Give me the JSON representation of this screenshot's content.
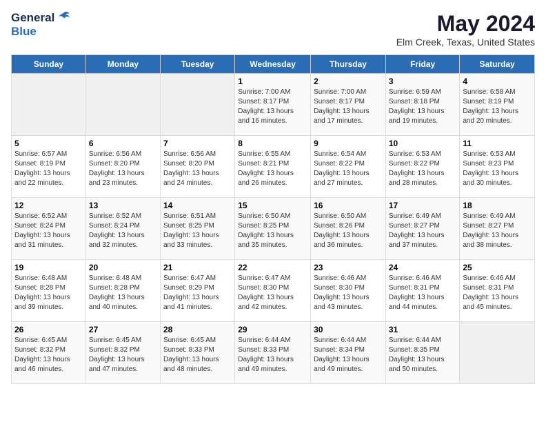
{
  "header": {
    "logo_general": "General",
    "logo_blue": "Blue",
    "title": "May 2024",
    "subtitle": "Elm Creek, Texas, United States"
  },
  "calendar": {
    "days_of_week": [
      "Sunday",
      "Monday",
      "Tuesday",
      "Wednesday",
      "Thursday",
      "Friday",
      "Saturday"
    ],
    "weeks": [
      [
        {
          "day": "",
          "info": ""
        },
        {
          "day": "",
          "info": ""
        },
        {
          "day": "",
          "info": ""
        },
        {
          "day": "1",
          "info": "Sunrise: 7:00 AM\nSunset: 8:17 PM\nDaylight: 13 hours\nand 16 minutes."
        },
        {
          "day": "2",
          "info": "Sunrise: 7:00 AM\nSunset: 8:17 PM\nDaylight: 13 hours\nand 17 minutes."
        },
        {
          "day": "3",
          "info": "Sunrise: 6:59 AM\nSunset: 8:18 PM\nDaylight: 13 hours\nand 19 minutes."
        },
        {
          "day": "4",
          "info": "Sunrise: 6:58 AM\nSunset: 8:19 PM\nDaylight: 13 hours\nand 20 minutes."
        }
      ],
      [
        {
          "day": "5",
          "info": "Sunrise: 6:57 AM\nSunset: 8:19 PM\nDaylight: 13 hours\nand 22 minutes."
        },
        {
          "day": "6",
          "info": "Sunrise: 6:56 AM\nSunset: 8:20 PM\nDaylight: 13 hours\nand 23 minutes."
        },
        {
          "day": "7",
          "info": "Sunrise: 6:56 AM\nSunset: 8:20 PM\nDaylight: 13 hours\nand 24 minutes."
        },
        {
          "day": "8",
          "info": "Sunrise: 6:55 AM\nSunset: 8:21 PM\nDaylight: 13 hours\nand 26 minutes."
        },
        {
          "day": "9",
          "info": "Sunrise: 6:54 AM\nSunset: 8:22 PM\nDaylight: 13 hours\nand 27 minutes."
        },
        {
          "day": "10",
          "info": "Sunrise: 6:53 AM\nSunset: 8:22 PM\nDaylight: 13 hours\nand 28 minutes."
        },
        {
          "day": "11",
          "info": "Sunrise: 6:53 AM\nSunset: 8:23 PM\nDaylight: 13 hours\nand 30 minutes."
        }
      ],
      [
        {
          "day": "12",
          "info": "Sunrise: 6:52 AM\nSunset: 8:24 PM\nDaylight: 13 hours\nand 31 minutes."
        },
        {
          "day": "13",
          "info": "Sunrise: 6:52 AM\nSunset: 8:24 PM\nDaylight: 13 hours\nand 32 minutes."
        },
        {
          "day": "14",
          "info": "Sunrise: 6:51 AM\nSunset: 8:25 PM\nDaylight: 13 hours\nand 33 minutes."
        },
        {
          "day": "15",
          "info": "Sunrise: 6:50 AM\nSunset: 8:25 PM\nDaylight: 13 hours\nand 35 minutes."
        },
        {
          "day": "16",
          "info": "Sunrise: 6:50 AM\nSunset: 8:26 PM\nDaylight: 13 hours\nand 36 minutes."
        },
        {
          "day": "17",
          "info": "Sunrise: 6:49 AM\nSunset: 8:27 PM\nDaylight: 13 hours\nand 37 minutes."
        },
        {
          "day": "18",
          "info": "Sunrise: 6:49 AM\nSunset: 8:27 PM\nDaylight: 13 hours\nand 38 minutes."
        }
      ],
      [
        {
          "day": "19",
          "info": "Sunrise: 6:48 AM\nSunset: 8:28 PM\nDaylight: 13 hours\nand 39 minutes."
        },
        {
          "day": "20",
          "info": "Sunrise: 6:48 AM\nSunset: 8:28 PM\nDaylight: 13 hours\nand 40 minutes."
        },
        {
          "day": "21",
          "info": "Sunrise: 6:47 AM\nSunset: 8:29 PM\nDaylight: 13 hours\nand 41 minutes."
        },
        {
          "day": "22",
          "info": "Sunrise: 6:47 AM\nSunset: 8:30 PM\nDaylight: 13 hours\nand 42 minutes."
        },
        {
          "day": "23",
          "info": "Sunrise: 6:46 AM\nSunset: 8:30 PM\nDaylight: 13 hours\nand 43 minutes."
        },
        {
          "day": "24",
          "info": "Sunrise: 6:46 AM\nSunset: 8:31 PM\nDaylight: 13 hours\nand 44 minutes."
        },
        {
          "day": "25",
          "info": "Sunrise: 6:46 AM\nSunset: 8:31 PM\nDaylight: 13 hours\nand 45 minutes."
        }
      ],
      [
        {
          "day": "26",
          "info": "Sunrise: 6:45 AM\nSunset: 8:32 PM\nDaylight: 13 hours\nand 46 minutes."
        },
        {
          "day": "27",
          "info": "Sunrise: 6:45 AM\nSunset: 8:32 PM\nDaylight: 13 hours\nand 47 minutes."
        },
        {
          "day": "28",
          "info": "Sunrise: 6:45 AM\nSunset: 8:33 PM\nDaylight: 13 hours\nand 48 minutes."
        },
        {
          "day": "29",
          "info": "Sunrise: 6:44 AM\nSunset: 8:33 PM\nDaylight: 13 hours\nand 49 minutes."
        },
        {
          "day": "30",
          "info": "Sunrise: 6:44 AM\nSunset: 8:34 PM\nDaylight: 13 hours\nand 49 minutes."
        },
        {
          "day": "31",
          "info": "Sunrise: 6:44 AM\nSunset: 8:35 PM\nDaylight: 13 hours\nand 50 minutes."
        },
        {
          "day": "",
          "info": ""
        }
      ]
    ]
  }
}
